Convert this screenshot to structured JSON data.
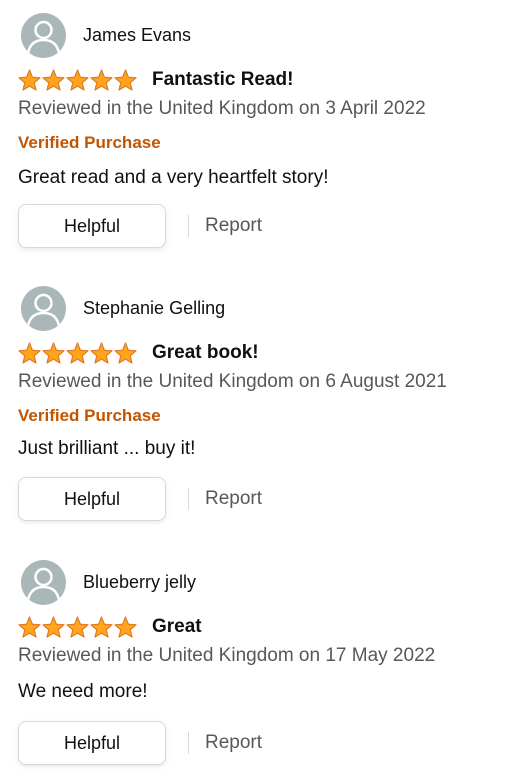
{
  "reviews": [
    {
      "reviewer": "James Evans",
      "stars": 5,
      "title": "Fantastic Read!",
      "date_line": "Reviewed in the United Kingdom on 3 April 2022",
      "verified": "Verified Purchase",
      "body": "Great read and a very heartfelt story!",
      "helpful_label": "Helpful",
      "report_label": "Report"
    },
    {
      "reviewer": "Stephanie Gelling",
      "stars": 5,
      "title": "Great book!",
      "date_line": "Reviewed in the United Kingdom on 6 August 2021",
      "verified": "Verified Purchase",
      "body": "Just brilliant ... buy it!",
      "helpful_label": "Helpful",
      "report_label": "Report"
    },
    {
      "reviewer": "Blueberry jelly",
      "stars": 5,
      "title": "Great",
      "date_line": "Reviewed in the United Kingdom on 17 May 2022",
      "body": "We need more!",
      "helpful_label": "Helpful",
      "report_label": "Report"
    }
  ],
  "colors": {
    "star": "#ffa41c",
    "star_outline": "#de7921",
    "verified": "#c45500",
    "avatar_bg": "#aab7b8"
  },
  "icons": {
    "avatar": "default-avatar-icon",
    "star": "star-icon"
  }
}
